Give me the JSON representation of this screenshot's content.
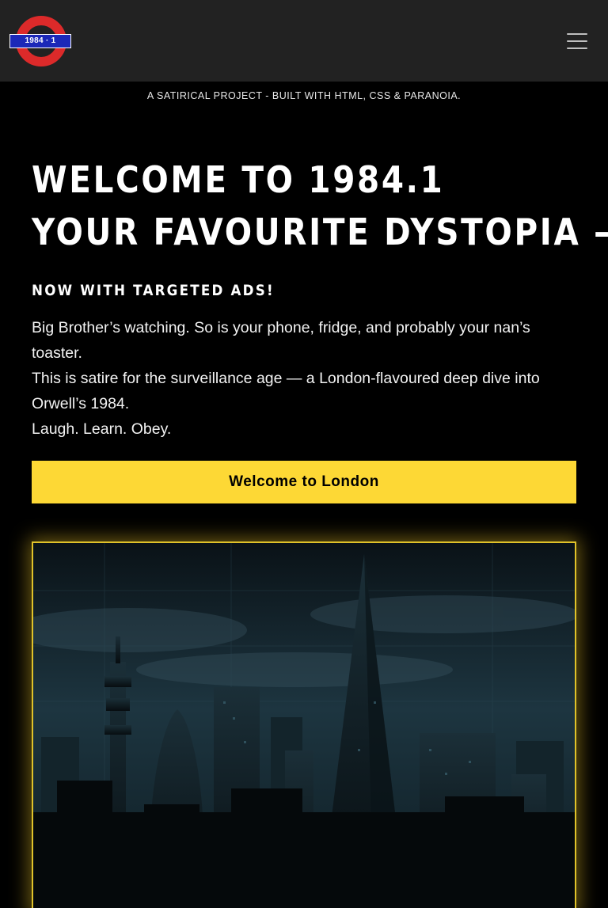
{
  "header": {
    "logo_text": "1984 · 1",
    "menu_icon": "hamburger-menu-icon"
  },
  "tagline": "A SATIRICAL PROJECT - BUILT WITH HTML, CSS & PARANOIA.",
  "hero": {
    "title_line1": "WELCOME TO 1984.1",
    "title_line2": "YOUR FAVOURITE DYSTOPIA —",
    "subtitle": "NOW WITH TARGETED ADS!",
    "body_line1": "Big Brother’s watching. So is your phone, fridge, and probably your nan’s toaster.",
    "body_line2": "This is satire for the surveillance age — a London-flavoured deep dive into Orwell’s 1984.",
    "body_line3": "Laugh. Learn. Obey.",
    "cta_label": "Welcome to London"
  },
  "colors": {
    "accent": "#fdd835",
    "roundel_red": "#dc2a2a",
    "roundel_blue": "#1b28b8",
    "header_bg": "#222222"
  }
}
